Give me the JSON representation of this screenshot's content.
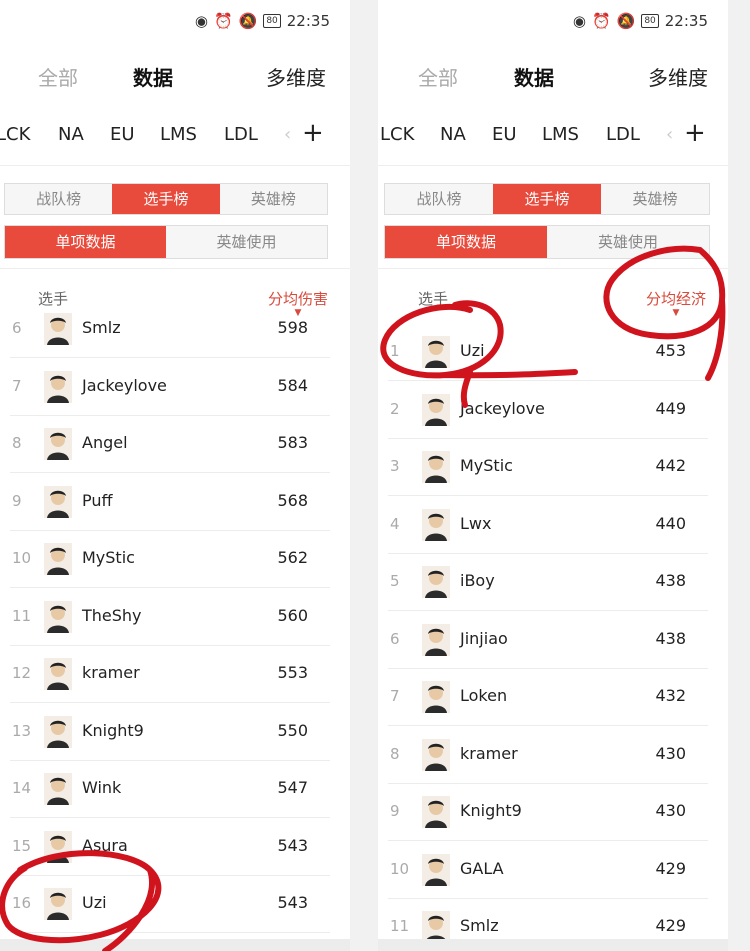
{
  "status": {
    "time": "22:35",
    "battery": "80",
    "icons": [
      "eye-icon",
      "alarm-icon",
      "bell-off-icon",
      "battery-icon"
    ]
  },
  "nav": {
    "tabs": [
      "全部",
      "数据",
      "多维度"
    ]
  },
  "leagues": {
    "items": [
      "LCK",
      "NA",
      "EU",
      "LMS",
      "LDL"
    ],
    "more": "‹",
    "add": "+"
  },
  "seg1": [
    "战队榜",
    "选手榜",
    "英雄榜"
  ],
  "seg2": [
    "单项数据",
    "英雄使用"
  ],
  "colors": {
    "accent": "#e84a3b",
    "annotation": "#d0141e"
  },
  "left": {
    "col_player": "选手",
    "stat": "分均伤害",
    "rows": [
      {
        "rank": "6",
        "name": "Smlz",
        "value": "598"
      },
      {
        "rank": "7",
        "name": "Jackeylove",
        "value": "584"
      },
      {
        "rank": "8",
        "name": "Angel",
        "value": "583"
      },
      {
        "rank": "9",
        "name": "Puff",
        "value": "568"
      },
      {
        "rank": "10",
        "name": "MyStic",
        "value": "562"
      },
      {
        "rank": "11",
        "name": "TheShy",
        "value": "560"
      },
      {
        "rank": "12",
        "name": "kramer",
        "value": "553"
      },
      {
        "rank": "13",
        "name": "Knight9",
        "value": "550"
      },
      {
        "rank": "14",
        "name": "Wink",
        "value": "547"
      },
      {
        "rank": "15",
        "name": "Asura",
        "value": "543"
      },
      {
        "rank": "16",
        "name": "Uzi",
        "value": "543"
      }
    ]
  },
  "right": {
    "col_player": "选手",
    "stat": "分均经济",
    "rows": [
      {
        "rank": "1",
        "name": "Uzi",
        "value": "453"
      },
      {
        "rank": "2",
        "name": "Jackeylove",
        "value": "449"
      },
      {
        "rank": "3",
        "name": "MyStic",
        "value": "442"
      },
      {
        "rank": "4",
        "name": "Lwx",
        "value": "440"
      },
      {
        "rank": "5",
        "name": "iBoy",
        "value": "438"
      },
      {
        "rank": "6",
        "name": "Jinjiao",
        "value": "438"
      },
      {
        "rank": "7",
        "name": "Loken",
        "value": "432"
      },
      {
        "rank": "8",
        "name": "kramer",
        "value": "430"
      },
      {
        "rank": "9",
        "name": "Knight9",
        "value": "430"
      },
      {
        "rank": "10",
        "name": "GALA",
        "value": "429"
      },
      {
        "rank": "11",
        "name": "Smlz",
        "value": "429"
      }
    ]
  }
}
